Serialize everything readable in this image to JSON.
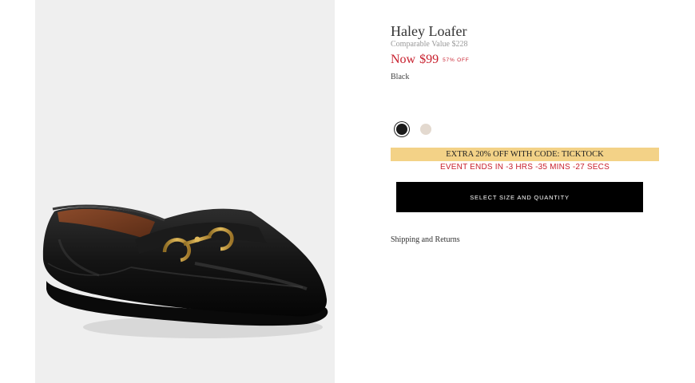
{
  "product": {
    "title": "Haley Loafer",
    "comparable_value": "Comparable Value $228",
    "now_label": "Now",
    "price": "$99",
    "discount": "57% OFF",
    "color_name": "Black",
    "swatches": [
      {
        "name": "black",
        "color": "#1a1a1a",
        "selected": true
      },
      {
        "name": "chalk",
        "color": "#e3d9cf",
        "selected": false
      }
    ]
  },
  "promo": {
    "code_text": "EXTRA 20% OFF WITH CODE: TICKTOCK",
    "event_text": "EVENT ENDS IN -3 HRS -35 MINS -27 SECS"
  },
  "actions": {
    "select_size_label": "SELECT SIZE AND QUANTITY",
    "shipping_label": "Shipping and Returns"
  },
  "colors": {
    "price_red": "#c8202e",
    "promo_yellow": "#f3d287",
    "image_bg": "#efefef"
  }
}
